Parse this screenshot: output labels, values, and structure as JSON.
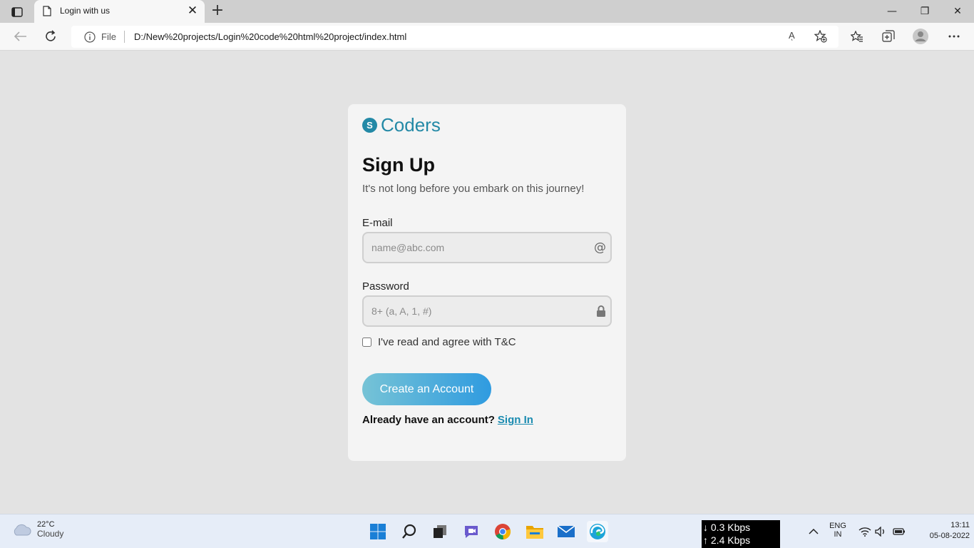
{
  "browser": {
    "tab_title": "Login with us",
    "close_glyph": "✕",
    "new_tab_glyph": "+",
    "address_label": "File",
    "url": "D:/New%20projects/Login%20code%20html%20project/index.html",
    "read_aloud_glyph": "Aͅ",
    "window_controls": {
      "minimize": "—",
      "restore": "❐",
      "close": "✕"
    }
  },
  "card": {
    "brand": "Coders",
    "brand_mark": "S",
    "title": "Sign Up",
    "subtitle": "It's not long before you embark on this journey!",
    "email": {
      "label": "E-mail",
      "placeholder": "name@abc.com",
      "icon": "@"
    },
    "password": {
      "label": "Password",
      "placeholder": "8+ (a, A, 1, #)"
    },
    "terms_label": "I've read and agree with T&C",
    "create_button": "Create an Account",
    "already_text": "Already have an account?",
    "signin_link": "Sign In"
  },
  "taskbar": {
    "temperature": "22°C",
    "condition": "Cloudy",
    "net_down": "↓ 0.3 Kbps",
    "net_up": "↑ 2.4 Kbps",
    "lang_1": "ENG",
    "lang_2": "IN",
    "time": "13:11",
    "date": "05-08-2022"
  },
  "colors": {
    "brand": "#2389a6",
    "link": "#1a8bb0",
    "button_start": "#76c3d6",
    "button_end": "#2f9be0"
  }
}
